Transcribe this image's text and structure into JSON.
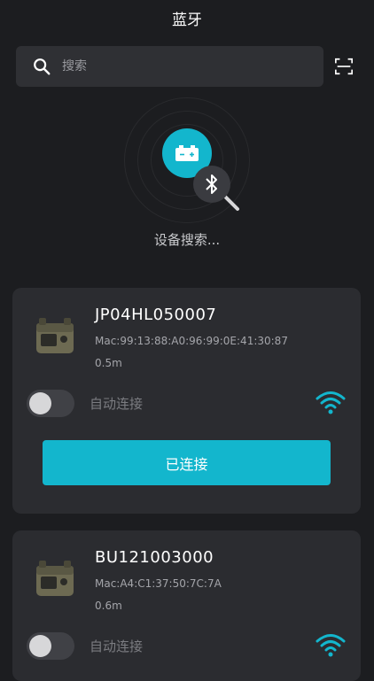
{
  "header": {
    "title": "蓝牙"
  },
  "search": {
    "placeholder": "搜索",
    "value": ""
  },
  "icons": {
    "search": "search-icon",
    "scan": "scan-icon",
    "battery": "battery-icon",
    "bluetooth_search": "bluetooth-search-icon",
    "device": "power-station-device-icon",
    "signal": "wifi-signal-icon"
  },
  "status": {
    "searching_text": "设备搜索..."
  },
  "colors": {
    "accent": "#13b6cd",
    "background": "#1c1d20",
    "card": "#2b2c30"
  },
  "devices": [
    {
      "name": "JP04HL050007",
      "mac": "Mac:99:13:88:A0:96:99:0E:41:30:87",
      "distance": "0.5m",
      "auto_connect_label": "自动连接",
      "auto_connect_enabled": false,
      "button_label": "已连接"
    },
    {
      "name": "BU121003000",
      "mac": "Mac:A4:C1:37:50:7C:7A",
      "distance": "0.6m",
      "auto_connect_label": "自动连接",
      "auto_connect_enabled": false
    }
  ]
}
